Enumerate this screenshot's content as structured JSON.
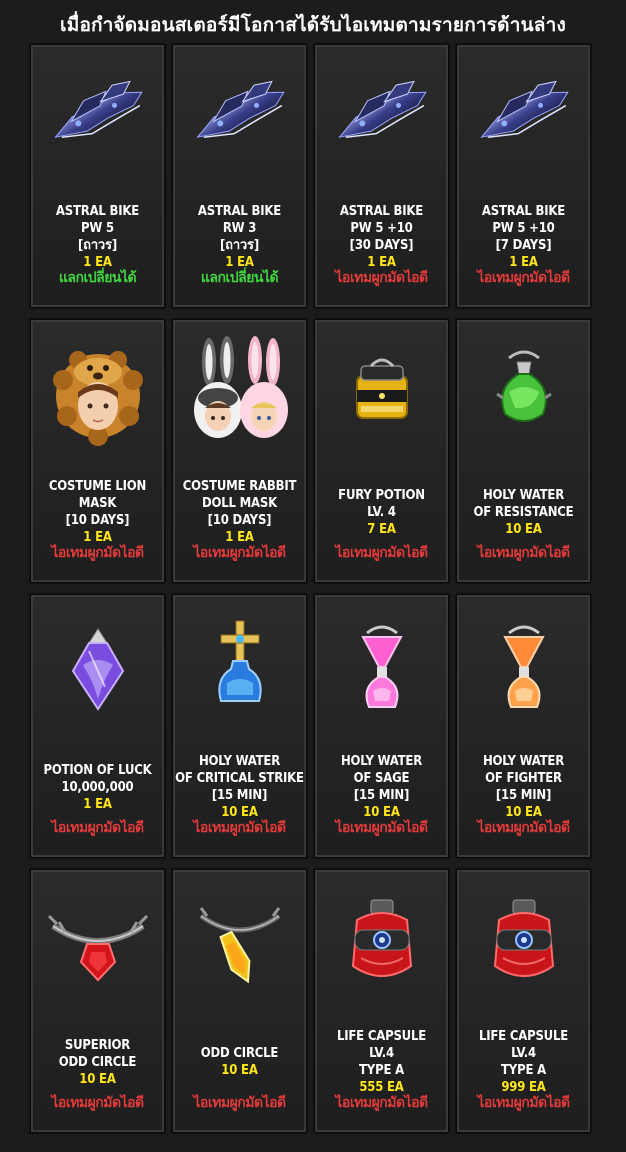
{
  "header": {
    "title": "เมื่อกำจัดมอนสเตอร์มีโอกาสได้รับไอเทมตามรายการด้านล่าง"
  },
  "colors": {
    "tradable": "#40d540",
    "bound": "#e03a3a",
    "quantity": "#ffe619",
    "name": "#ffffff"
  },
  "items": [
    {
      "icon": "astral-bike-icon",
      "name": [
        "ASTRAL BIKE",
        "PW 5",
        "[ถาวร]"
      ],
      "qty": "1 EA",
      "status": "แลกเปลี่ยนได้",
      "status_type": "tradable"
    },
    {
      "icon": "astral-bike-icon",
      "name": [
        "ASTRAL BIKE",
        "RW 3",
        "[ถาวร]"
      ],
      "qty": "1 EA",
      "status": "แลกเปลี่ยนได้",
      "status_type": "tradable"
    },
    {
      "icon": "astral-bike-icon",
      "name": [
        "ASTRAL BIKE",
        "PW 5 +10",
        "[30 DAYS]"
      ],
      "qty": "1 EA",
      "status": "ไอเทมผูกมัดไอดี",
      "status_type": "bound"
    },
    {
      "icon": "astral-bike-icon",
      "name": [
        "ASTRAL BIKE",
        "PW 5 +10",
        "[7 DAYS]"
      ],
      "qty": "1 EA",
      "status": "ไอเทมผูกมัดไอดี",
      "status_type": "bound"
    },
    {
      "icon": "lion-mask-icon",
      "name": [
        "COSTUME LION",
        "MASK",
        "[10 DAYS]"
      ],
      "qty": "1 EA",
      "status": "ไอเทมผูกมัดไอดี",
      "status_type": "bound"
    },
    {
      "icon": "rabbit-mask-icon",
      "name": [
        "COSTUME RABBIT",
        "DOLL MASK",
        "[10 DAYS]"
      ],
      "qty": "1 EA",
      "status": "ไอเทมผูกมัดไอดี",
      "status_type": "bound"
    },
    {
      "icon": "fury-potion-icon",
      "name": [
        "FURY POTION",
        "LV. 4"
      ],
      "qty": "7 EA",
      "status": "ไอเทมผูกมัดไอดี",
      "status_type": "bound"
    },
    {
      "icon": "holy-water-resistance-icon",
      "name": [
        "HOLY WATER",
        "OF RESISTANCE"
      ],
      "qty": "10 EA",
      "status": "ไอเทมผูกมัดไอดี",
      "status_type": "bound"
    },
    {
      "icon": "potion-of-luck-icon",
      "name": [
        "POTION OF LUCK",
        "10,000,000"
      ],
      "qty": "1 EA",
      "status": "ไอเทมผูกมัดไอดี",
      "status_type": "bound"
    },
    {
      "icon": "holy-water-critical-icon",
      "name": [
        "HOLY WATER",
        "OF CRITICAL STRIKE",
        "[15 MIN]"
      ],
      "qty": "10 EA",
      "status": "ไอเทมผูกมัดไอดี",
      "status_type": "bound"
    },
    {
      "icon": "holy-water-sage-icon",
      "name": [
        "HOLY WATER",
        "OF SAGE",
        "[15 MIN]"
      ],
      "qty": "10 EA",
      "status": "ไอเทมผูกมัดไอดี",
      "status_type": "bound"
    },
    {
      "icon": "holy-water-fighter-icon",
      "name": [
        "HOLY WATER",
        "OF FIGHTER",
        "[15 MIN]"
      ],
      "qty": "10 EA",
      "status": "ไอเทมผูกมัดไอดี",
      "status_type": "bound"
    },
    {
      "icon": "superior-odd-circle-icon",
      "name": [
        "SUPERIOR",
        "ODD CIRCLE"
      ],
      "qty": "10 EA",
      "status": "ไอเทมผูกมัดไอดี",
      "status_type": "bound"
    },
    {
      "icon": "odd-circle-icon",
      "name": [
        "ODD CIRCLE"
      ],
      "qty": "10 EA",
      "status": "ไอเทมผูกมัดไอดี",
      "status_type": "bound"
    },
    {
      "icon": "life-capsule-icon",
      "name": [
        "LIFE CAPSULE",
        "LV.4",
        "TYPE A"
      ],
      "qty": "555 EA",
      "status": "ไอเทมผูกมัดไอดี",
      "status_type": "bound"
    },
    {
      "icon": "life-capsule-icon",
      "name": [
        "LIFE CAPSULE",
        "LV.4",
        "TYPE A"
      ],
      "qty": "999 EA",
      "status": "ไอเทมผูกมัดไอดี",
      "status_type": "bound"
    }
  ]
}
